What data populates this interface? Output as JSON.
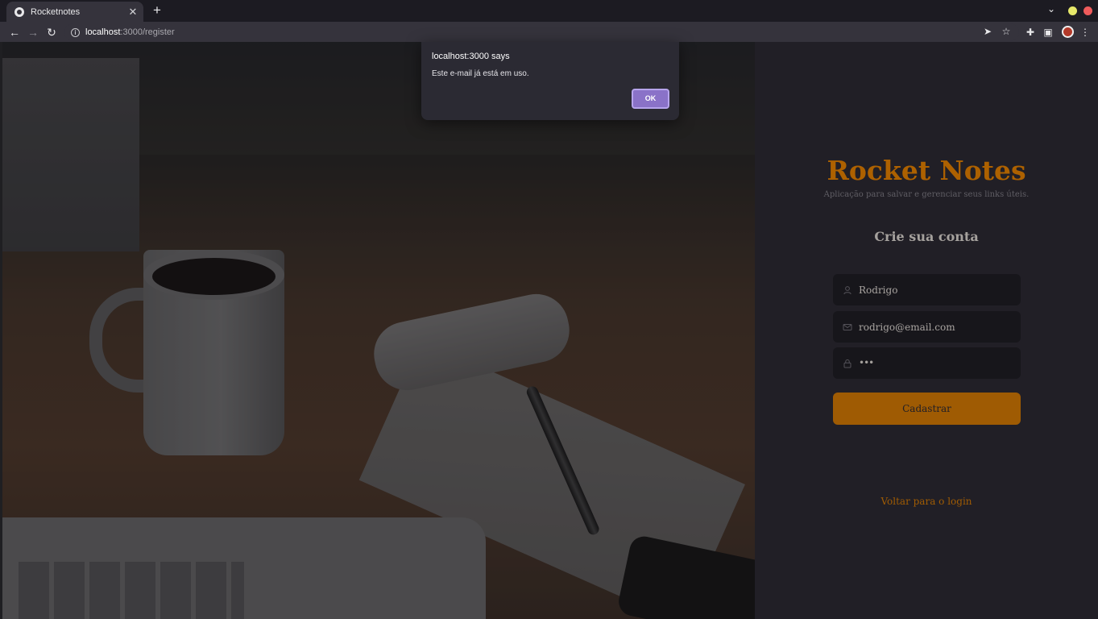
{
  "browser": {
    "tab_title": "Rocketnotes",
    "url_host": "localhost",
    "url_path": ":3000/register"
  },
  "app": {
    "brand": "Rocket Notes",
    "tagline": "Aplicação para salvar e gerenciar seus links úteis.",
    "form_title": "Crie sua conta",
    "fields": {
      "name_value": "Rodrigo",
      "email_value": "rodrigo@email.com",
      "password_display": "•••"
    },
    "submit_label": "Cadastrar",
    "back_link": "Voltar para o login"
  },
  "alert": {
    "title": "localhost:3000 says",
    "message": "Este e-mail já está em uso.",
    "ok_label": "OK"
  },
  "colors": {
    "accent": "#ff9000",
    "panel_bg": "#312e38",
    "input_bg": "#232129",
    "dialog_button": "#8a72c8"
  },
  "icons": [
    "globe-icon",
    "close-icon",
    "plus-icon",
    "back-arrow-icon",
    "forward-arrow-icon",
    "reload-icon",
    "info-icon",
    "send-icon",
    "star-icon",
    "puzzle-icon",
    "sidebar-icon",
    "kebab-menu-icon",
    "user-icon",
    "mail-icon",
    "lock-icon"
  ]
}
